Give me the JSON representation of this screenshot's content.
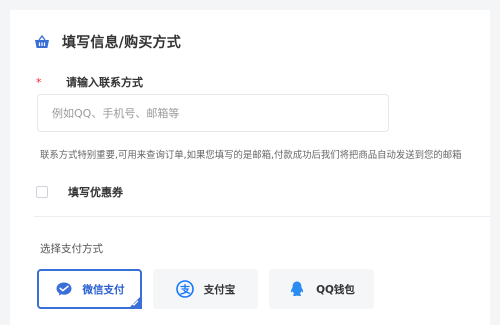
{
  "section": {
    "title": "填写信息/购买方式"
  },
  "contact": {
    "required_mark": "*",
    "label": "请输入联系方式",
    "value": "",
    "placeholder": "例如QQ、手机号、邮箱等",
    "hint": "联系方式特别重要,可用来查询订单,如果您填写的是邮箱,付款成功后我们将把商品自动发送到您的邮箱"
  },
  "coupon": {
    "label": "填写优惠券",
    "checked": false
  },
  "payment": {
    "heading": "选择支付方式",
    "methods": [
      {
        "label": "微信支付",
        "icon": "wechat-pay-icon",
        "selected": true
      },
      {
        "label": "支付宝",
        "icon": "alipay-icon",
        "selected": false
      },
      {
        "label": "QQ钱包",
        "icon": "qq-wallet-icon",
        "selected": false
      }
    ]
  },
  "colors": {
    "accent": "#3a6fd8",
    "required": "#f5222d",
    "alipay": "#1677ff",
    "qq": "#2a8cf0"
  }
}
